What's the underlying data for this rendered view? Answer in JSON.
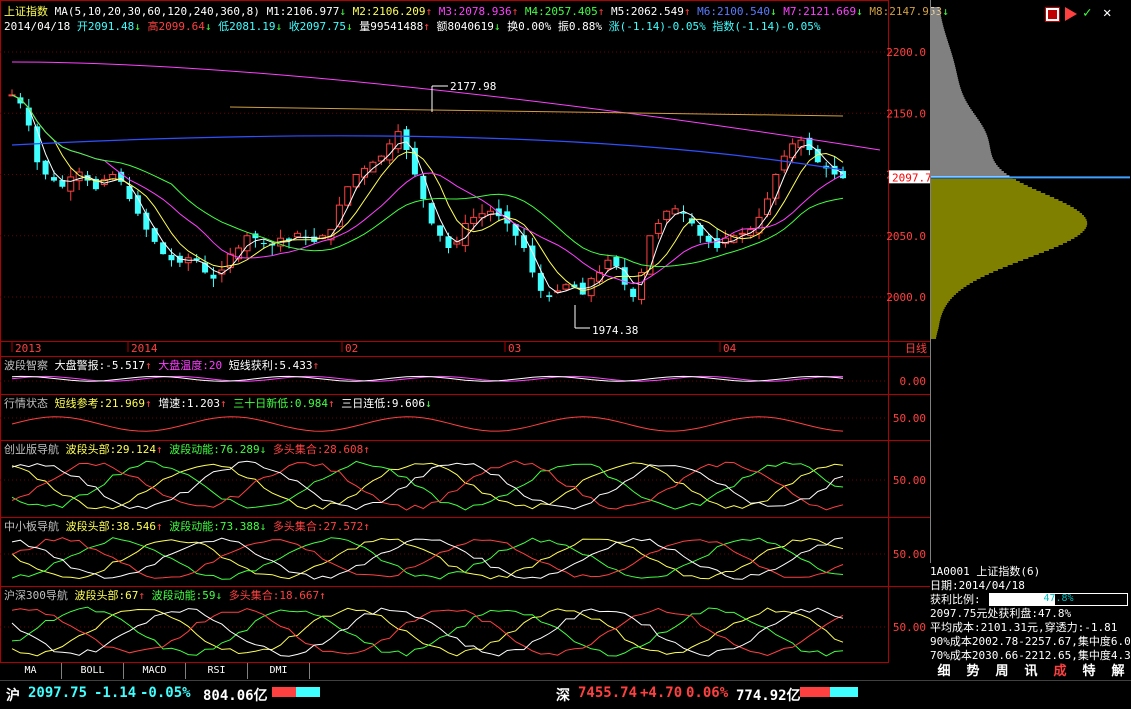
{
  "main": {
    "index_name": "上证指数",
    "ma_label": "MA(5,10,20,30,60,120,240,360,8)",
    "ma_values": [
      {
        "name": "M1",
        "val": "2106.977",
        "arrow": "↓",
        "color": "#ffffff"
      },
      {
        "name": "M2",
        "val": "2106.209",
        "arrow": "↑",
        "color": "#ffff54"
      },
      {
        "name": "M3",
        "val": "2078.936",
        "arrow": "↑",
        "color": "#ff40ff"
      },
      {
        "name": "M4",
        "val": "2057.405",
        "arrow": "↑",
        "color": "#40ff40"
      },
      {
        "name": "M5",
        "val": "2062.549",
        "arrow": "↑",
        "color": "#ffffff"
      },
      {
        "name": "M6",
        "val": "2100.540",
        "arrow": "↓",
        "color": "#5a7bff"
      },
      {
        "name": "M7",
        "val": "2121.669",
        "arrow": "↓",
        "color": "#ff40ff"
      },
      {
        "name": "M8",
        "val": "2147.953",
        "arrow": "↓",
        "color": "#d0a040"
      }
    ],
    "day_line": [
      {
        "t": "2014/04/18",
        "c": "#ffffff"
      },
      {
        "t": "开2091.48",
        "c": "#40ffff"
      },
      {
        "t": "↓",
        "c": "#40ff40"
      },
      {
        "t": "高2099.64",
        "c": "#ff4040"
      },
      {
        "t": "↓",
        "c": "#40ff40"
      },
      {
        "t": "低2081.19",
        "c": "#40ffff"
      },
      {
        "t": "↓",
        "c": "#40ff40"
      },
      {
        "t": "收2097.75",
        "c": "#40ffff"
      },
      {
        "t": "↓",
        "c": "#40ff40"
      },
      {
        "t": "量99541488",
        "c": "#ffffff"
      },
      {
        "t": "↑",
        "c": "#ff4040"
      },
      {
        "t": "额8040619",
        "c": "#ffffff"
      },
      {
        "t": "↓",
        "c": "#40ff40"
      },
      {
        "t": "换0.00%",
        "c": "#ffffff"
      },
      {
        "t": "振0.88%",
        "c": "#ffffff"
      },
      {
        "t": "涨(-1.14)-0.05%",
        "c": "#40ffff"
      },
      {
        "t": "指数(-1.14)-0.05%",
        "c": "#40ffff"
      }
    ],
    "yaxis": [
      "2200.0",
      "2150.0",
      "2100.0",
      "2050.0",
      "2000.0"
    ],
    "current_price": "2097.7",
    "high_label": "2177.98",
    "low_label": "1974.38",
    "xaxis": [
      "2013",
      "2014",
      "02",
      "03",
      "04"
    ],
    "period": "日线"
  },
  "panels": [
    {
      "id": "p1",
      "name": "波段智察",
      "items": [
        {
          "t": "大盘警报:-5.517",
          "a": "↑",
          "c": "#ffffff",
          "ac": "#ff4040"
        },
        {
          "t": "大盘温度:20",
          "a": "",
          "c": "#ff40ff",
          "ac": "#ff4040"
        },
        {
          "t": "短线获利:5.433",
          "a": "↑",
          "c": "#ffffff",
          "ac": "#ff4040"
        }
      ],
      "ylabel": "0.00"
    },
    {
      "id": "p2",
      "name": "行情状态",
      "items": [
        {
          "t": "短线参考:21.969",
          "a": "↑",
          "c": "#ffff54",
          "ac": "#ff4040"
        },
        {
          "t": "增速:1.203",
          "a": "↑",
          "c": "#ffffff",
          "ac": "#ff4040"
        },
        {
          "t": "三十日新低:0.984",
          "a": "↑",
          "c": "#40ff40",
          "ac": "#ff4040"
        },
        {
          "t": "三日连低:9.606",
          "a": "↓",
          "c": "#ffffff",
          "ac": "#40ff40"
        }
      ],
      "ylabel": "50.00"
    },
    {
      "id": "p3",
      "name": "创业版导航",
      "items": [
        {
          "t": "波段头部:29.124",
          "a": "↑",
          "c": "#ffff54",
          "ac": "#ff4040"
        },
        {
          "t": "波段动能:76.289",
          "a": "↓",
          "c": "#40ff40",
          "ac": "#40ff40"
        },
        {
          "t": "多头集合:28.608",
          "a": "↑",
          "c": "#ff4040",
          "ac": "#ff4040"
        }
      ],
      "ylabel": "50.00"
    },
    {
      "id": "p4",
      "name": "中小板导航",
      "items": [
        {
          "t": "波段头部:38.546",
          "a": "↑",
          "c": "#ffff54",
          "ac": "#ff4040"
        },
        {
          "t": "波段动能:73.388",
          "a": "↓",
          "c": "#40ff40",
          "ac": "#40ff40"
        },
        {
          "t": "多头集合:27.572",
          "a": "↑",
          "c": "#ff4040",
          "ac": "#ff4040"
        }
      ],
      "ylabel": "50.00"
    },
    {
      "id": "p5",
      "name": "沪深300导航",
      "items": [
        {
          "t": "波段头部:67",
          "a": "↑",
          "c": "#ffff54",
          "ac": "#ff4040"
        },
        {
          "t": "波段动能:59",
          "a": "↓",
          "c": "#40ff40",
          "ac": "#40ff40"
        },
        {
          "t": "多头集合:18.667",
          "a": "↑",
          "c": "#ff4040",
          "ac": "#ff4040"
        }
      ],
      "ylabel": "50.00"
    }
  ],
  "tabs": [
    "MA",
    "BOLL",
    "MACD",
    "RSI",
    "DMI"
  ],
  "right": {
    "code_line": "1A0001 上证指数(6)",
    "date_line": "日期:2014/04/18",
    "profit_ratio_label": "获利比例:",
    "profit_ratio_value": "47.8%",
    "profit_ratio": 0.478,
    "line3": "2097.75元处获利盘:47.8%",
    "line4": "平均成本:2101.31元,穿透力:-1.81",
    "line5": "90%成本2002.78-2257.67,集中度6.0",
    "line6": "70%成本2030.66-2212.65,集中度4.3",
    "tabs": [
      "细",
      "势",
      "周",
      "讯",
      "成",
      "特",
      "解"
    ],
    "active_tab": "成"
  },
  "status": {
    "sh_label": "沪",
    "sh_price": "2097.75",
    "sh_change": "-1.14",
    "sh_pct": "-0.05%",
    "sh_amount": "804.06亿",
    "sz_label": "深",
    "sz_price": "7455.74",
    "sz_change": "+4.70",
    "sz_pct": "0.06%",
    "sz_amount": "774.92亿"
  },
  "colors": {
    "up": "#ff4040",
    "down": "#40ffff",
    "frame": "#b00000"
  }
}
